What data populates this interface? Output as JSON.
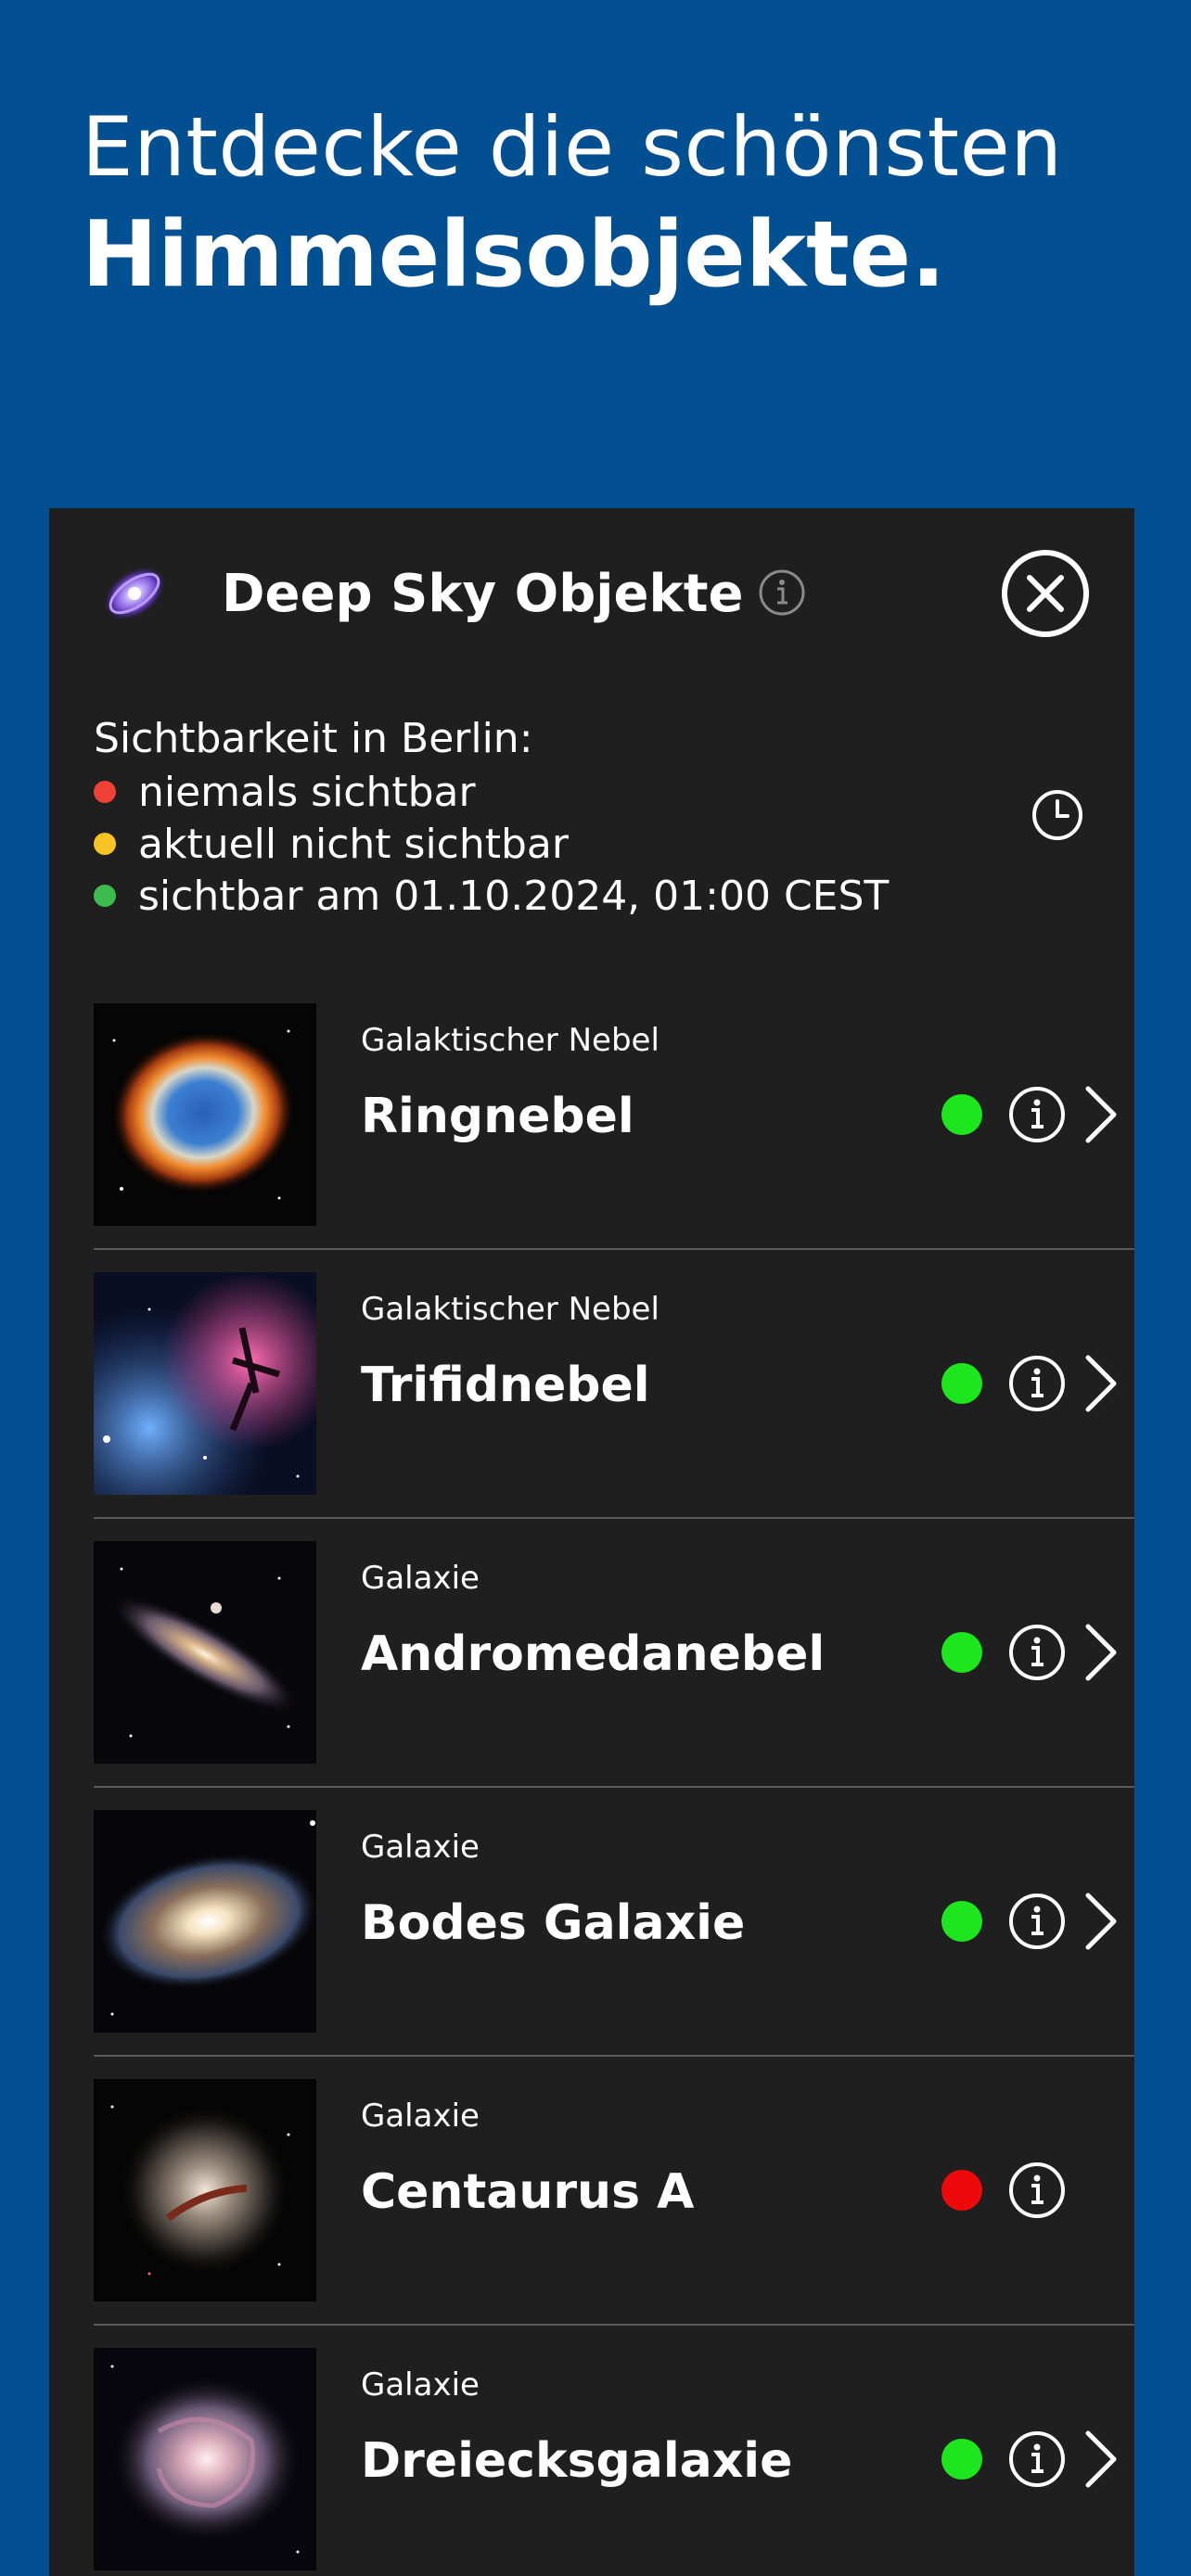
{
  "headline": {
    "line1": "Entdecke die schönsten",
    "line2": "Himmelsobjekte."
  },
  "panel": {
    "title": "Deep Sky Objekte",
    "logo_icon": "galaxy-icon",
    "info_icon": "info-icon",
    "close_icon": "close-icon"
  },
  "legend": {
    "title": "Sichtbarkeit in Berlin:",
    "items": [
      {
        "label": "niemals sichtbar",
        "color": "#ef4136"
      },
      {
        "label": "aktuell nicht sichtbar",
        "color": "#f7c325"
      },
      {
        "label": "sichtbar am 01.10.2024, 01:00 CEST",
        "color": "#3dbb4f"
      }
    ],
    "clock_icon": "clock-icon"
  },
  "objects": [
    {
      "category": "Galaktischer Nebel",
      "name": "Ringnebel",
      "status_color": "#1ee61e",
      "has_details": true
    },
    {
      "category": "Galaktischer Nebel",
      "name": "Trifidnebel",
      "status_color": "#1ee61e",
      "has_details": true
    },
    {
      "category": "Galaxie",
      "name": "Andromedanebel",
      "status_color": "#1ee61e",
      "has_details": true
    },
    {
      "category": "Galaxie",
      "name": "Bodes Galaxie",
      "status_color": "#1ee61e",
      "has_details": true
    },
    {
      "category": "Galaxie",
      "name": "Centaurus A",
      "status_color": "#ee0a0a",
      "has_details": false
    },
    {
      "category": "Galaxie",
      "name": "Dreiecksgalaxie",
      "status_color": "#1ee61e",
      "has_details": true
    }
  ],
  "colors": {
    "background": "#024f91",
    "panel": "#1f1f1f",
    "divider": "#5a5a5a"
  }
}
